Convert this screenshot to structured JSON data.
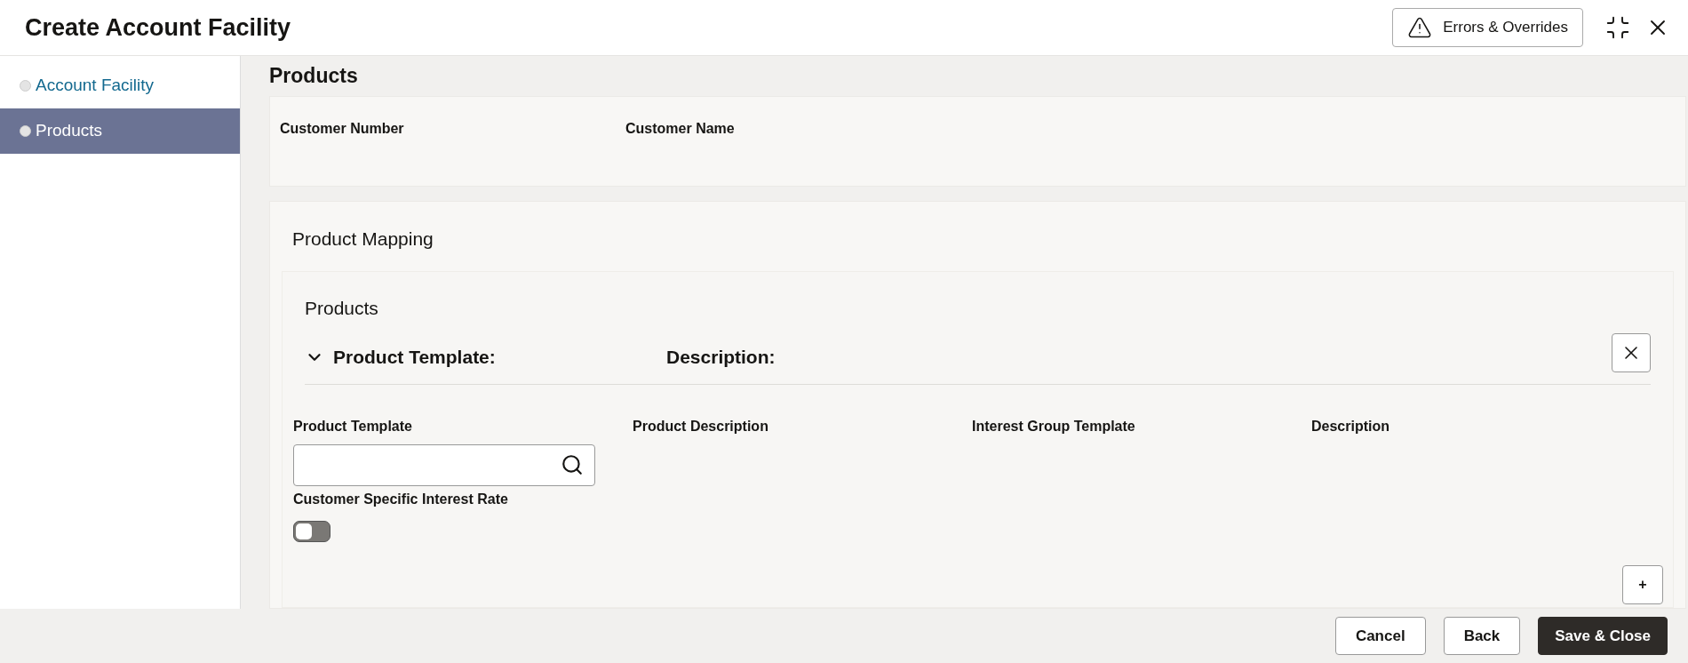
{
  "window": {
    "title": "Create Account Facility",
    "errors_button": "Errors & Overrides"
  },
  "sidebar": {
    "items": [
      {
        "label": "Account Facility",
        "selected": false
      },
      {
        "label": "Products",
        "selected": true
      }
    ]
  },
  "page_title": "Products",
  "customer": {
    "fields": [
      "Customer Number",
      "Customer Name"
    ]
  },
  "product_mapping": {
    "title": "Product Mapping",
    "section_title": "Products",
    "row": {
      "expanded": true,
      "template_label": "Product Template:",
      "description_label": "Description:",
      "columns": [
        "Product Template",
        "Product Description",
        "Interest Group Template",
        "Description"
      ],
      "toggle": {
        "label": "Customer Specific Interest Rate",
        "on": false
      }
    },
    "add_button": "+"
  },
  "footer": {
    "buttons": [
      "Cancel",
      "Back",
      "Save & Close"
    ]
  }
}
